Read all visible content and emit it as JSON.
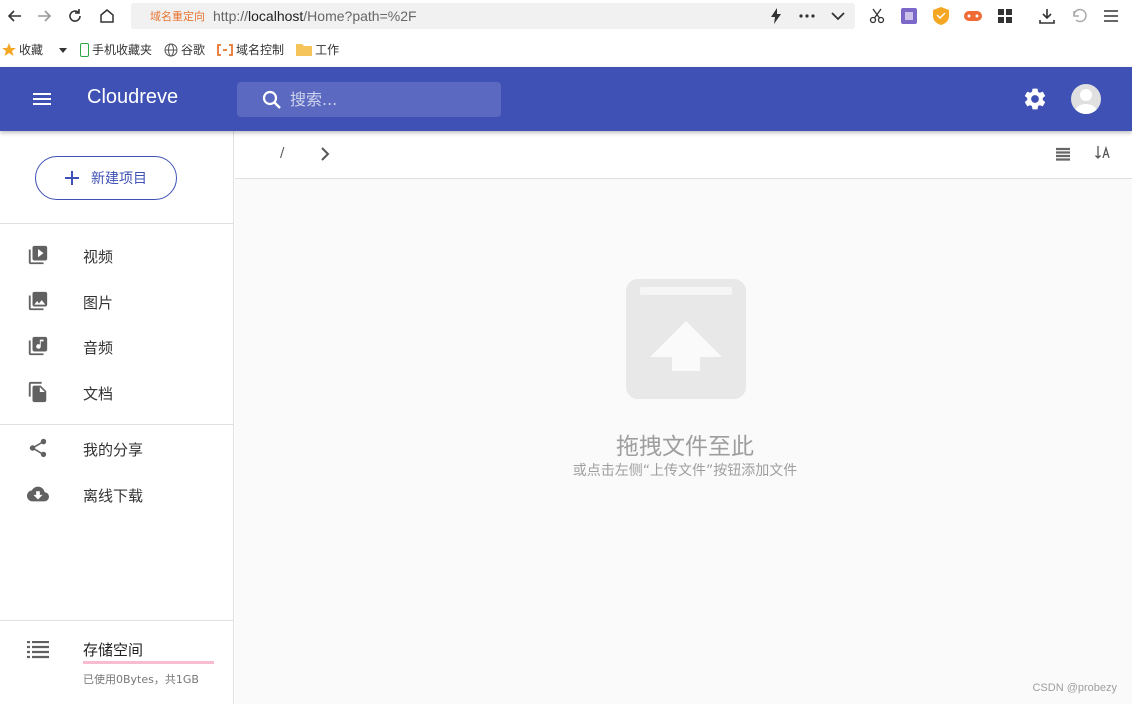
{
  "browser": {
    "redirect_label": "域名重定向",
    "url_prefix": "http://",
    "url_host": "localhost",
    "url_path": "/Home?path=%2F",
    "bookmarks": [
      {
        "label": "收藏",
        "icon": "star-icon"
      },
      {
        "label": "手机收藏夹",
        "icon": "phone-icon"
      },
      {
        "label": "谷歌",
        "icon": "globe-icon"
      },
      {
        "label": "域名控制",
        "icon": "domain-icon"
      },
      {
        "label": "工作",
        "icon": "folder-icon"
      }
    ]
  },
  "appbar": {
    "title": "Cloudreve",
    "search_placeholder": "搜索..."
  },
  "sidebar": {
    "new_button": "新建项目",
    "items": [
      {
        "label": "视频",
        "icon": "video-library-icon"
      },
      {
        "label": "图片",
        "icon": "photo-library-icon"
      },
      {
        "label": "音频",
        "icon": "music-library-icon"
      },
      {
        "label": "文档",
        "icon": "file-copy-icon"
      },
      {
        "label": "我的分享",
        "icon": "share-icon"
      },
      {
        "label": "离线下载",
        "icon": "cloud-download-icon"
      }
    ],
    "storage": {
      "title": "存储空间",
      "usage": "已使用0Bytes，共1GB",
      "used_fraction": 0.0
    }
  },
  "main": {
    "breadcrumb_root": "/",
    "empty_title": "拖拽文件至此",
    "empty_subtitle": "或点击左侧“上传文件”按钮添加文件",
    "watermark": "CSDN @probezy"
  },
  "colors": {
    "primary": "#3f51b5",
    "storage_bar": "#f48fb1"
  }
}
